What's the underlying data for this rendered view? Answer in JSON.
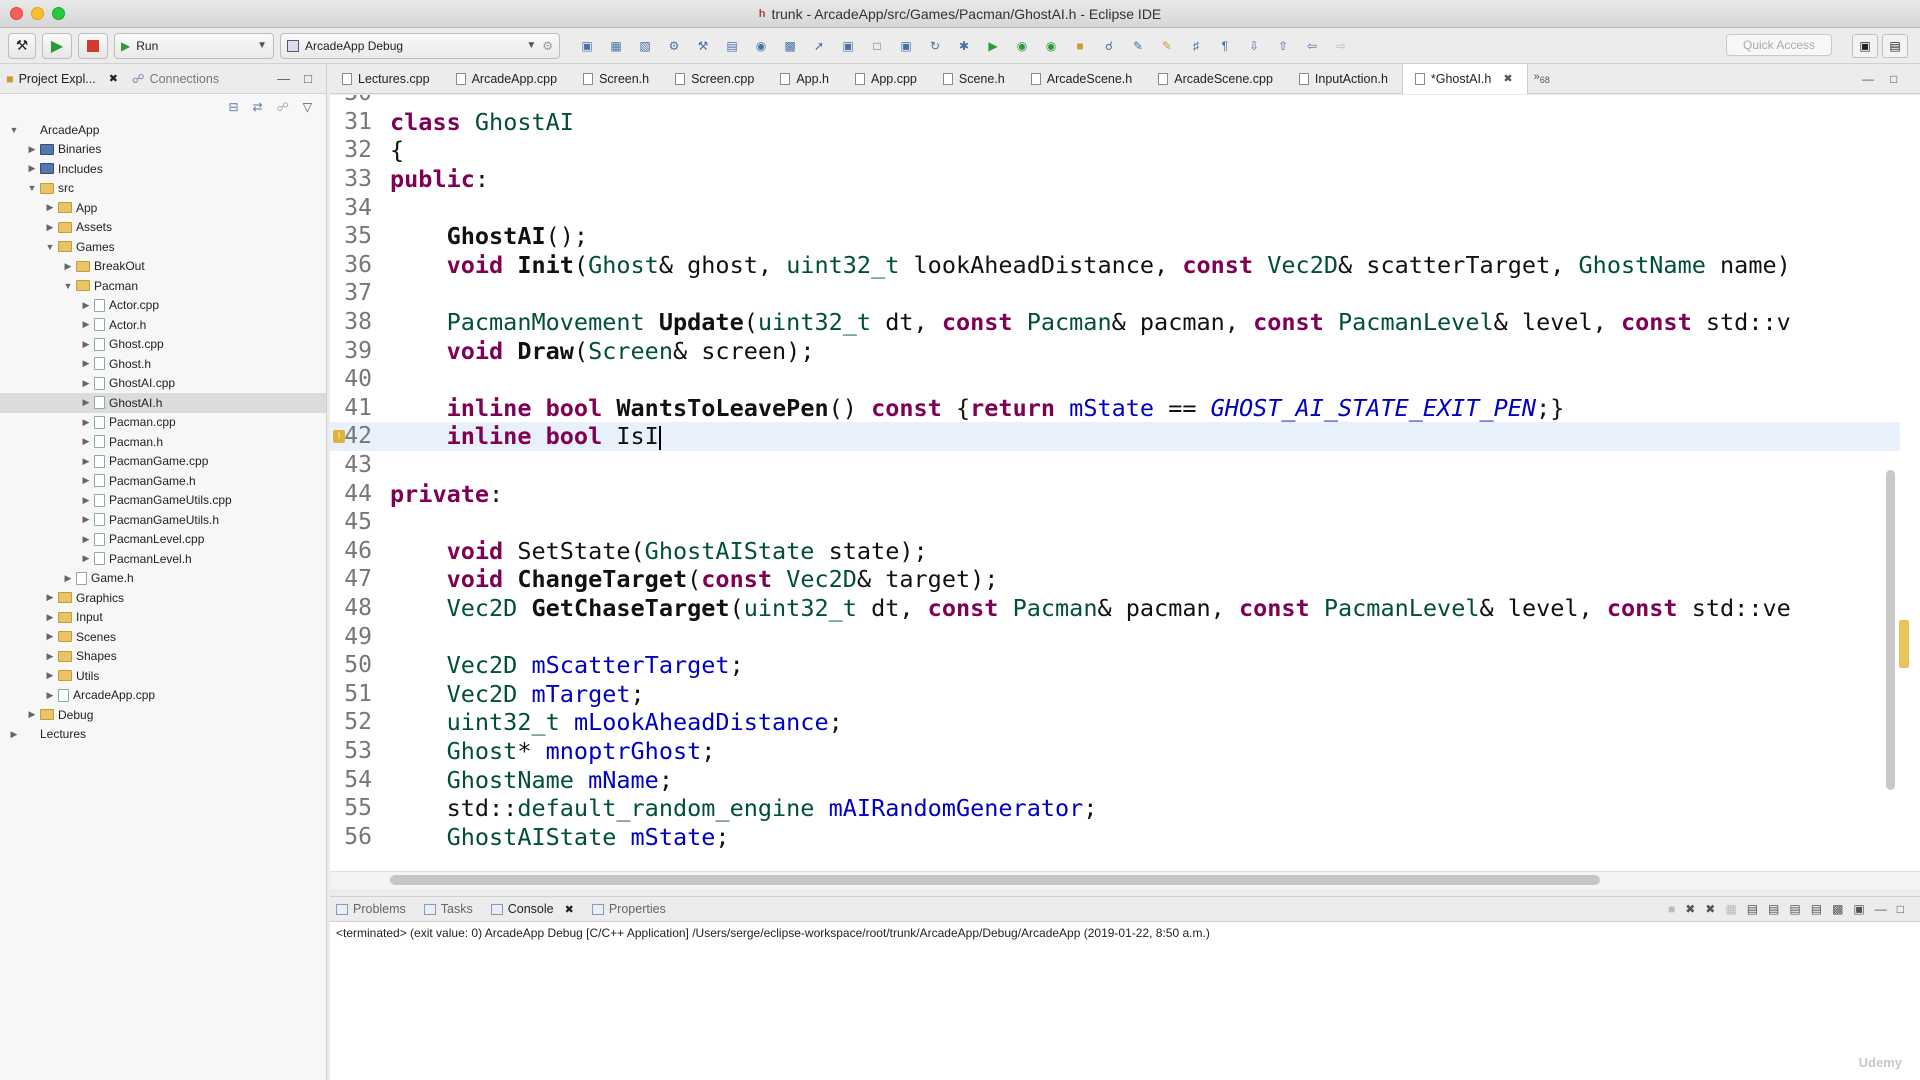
{
  "window": {
    "title": "trunk - ArcadeApp/src/Games/Pacman/GhostAI.h - Eclipse IDE"
  },
  "toolbar": {
    "run_label": "Run",
    "config_label": "ArcadeApp Debug",
    "quick_access_placeholder": "Quick Access"
  },
  "left_panel": {
    "tabs": [
      {
        "label": "Project Expl..."
      },
      {
        "label": "Connections"
      }
    ],
    "tree": [
      {
        "label": "ArcadeApp",
        "depth": 0,
        "kind": "project",
        "open": true
      },
      {
        "label": "Binaries",
        "depth": 1,
        "kind": "bin",
        "open": false
      },
      {
        "label": "Includes",
        "depth": 1,
        "kind": "bin",
        "open": false
      },
      {
        "label": "src",
        "depth": 1,
        "kind": "folder",
        "open": true
      },
      {
        "label": "App",
        "depth": 2,
        "kind": "folder",
        "open": false
      },
      {
        "label": "Assets",
        "depth": 2,
        "kind": "folder",
        "open": false
      },
      {
        "label": "Games",
        "depth": 2,
        "kind": "folder",
        "open": true
      },
      {
        "label": "BreakOut",
        "depth": 3,
        "kind": "folder",
        "open": false
      },
      {
        "label": "Pacman",
        "depth": 3,
        "kind": "folder",
        "open": true
      },
      {
        "label": "Actor.cpp",
        "depth": 4,
        "kind": "file",
        "open": false
      },
      {
        "label": "Actor.h",
        "depth": 4,
        "kind": "file",
        "open": false
      },
      {
        "label": "Ghost.cpp",
        "depth": 4,
        "kind": "file",
        "open": false
      },
      {
        "label": "Ghost.h",
        "depth": 4,
        "kind": "file",
        "open": false
      },
      {
        "label": "GhostAI.cpp",
        "depth": 4,
        "kind": "file",
        "open": false
      },
      {
        "label": "GhostAI.h",
        "depth": 4,
        "kind": "file",
        "open": false,
        "selected": true
      },
      {
        "label": "Pacman.cpp",
        "depth": 4,
        "kind": "file",
        "open": false
      },
      {
        "label": "Pacman.h",
        "depth": 4,
        "kind": "file",
        "open": false
      },
      {
        "label": "PacmanGame.cpp",
        "depth": 4,
        "kind": "file",
        "open": false
      },
      {
        "label": "PacmanGame.h",
        "depth": 4,
        "kind": "file",
        "open": false
      },
      {
        "label": "PacmanGameUtils.cpp",
        "depth": 4,
        "kind": "file",
        "open": false
      },
      {
        "label": "PacmanGameUtils.h",
        "depth": 4,
        "kind": "file",
        "open": false
      },
      {
        "label": "PacmanLevel.cpp",
        "depth": 4,
        "kind": "file",
        "open": false
      },
      {
        "label": "PacmanLevel.h",
        "depth": 4,
        "kind": "file",
        "open": false
      },
      {
        "label": "Game.h",
        "depth": 3,
        "kind": "file",
        "open": false
      },
      {
        "label": "Graphics",
        "depth": 2,
        "kind": "folder",
        "open": false
      },
      {
        "label": "Input",
        "depth": 2,
        "kind": "folder",
        "open": false
      },
      {
        "label": "Scenes",
        "depth": 2,
        "kind": "folder",
        "open": false
      },
      {
        "label": "Shapes",
        "depth": 2,
        "kind": "folder",
        "open": false
      },
      {
        "label": "Utils",
        "depth": 2,
        "kind": "folder",
        "open": false
      },
      {
        "label": "ArcadeApp.cpp",
        "depth": 2,
        "kind": "file",
        "open": false
      },
      {
        "label": "Debug",
        "depth": 1,
        "kind": "folder",
        "open": false
      },
      {
        "label": "Lectures",
        "depth": 0,
        "kind": "project",
        "open": false
      }
    ]
  },
  "editor_tabs": [
    {
      "label": "Lectures.cpp"
    },
    {
      "label": "ArcadeApp.cpp"
    },
    {
      "label": "Screen.h"
    },
    {
      "label": "Screen.cpp"
    },
    {
      "label": "App.h"
    },
    {
      "label": "App.cpp"
    },
    {
      "label": "Scene.h"
    },
    {
      "label": "ArcadeScene.h"
    },
    {
      "label": "ArcadeScene.cpp"
    },
    {
      "label": "InputAction.h"
    },
    {
      "label": "*GhostAI.h",
      "active": true
    }
  ],
  "editor_tabs_overflow": "68",
  "code_lines": [
    {
      "n": "30",
      "html": ""
    },
    {
      "n": "31",
      "html": "<span class=\"kw\">class</span> <span class=\"ty\">GhostAI</span>"
    },
    {
      "n": "32",
      "html": "{"
    },
    {
      "n": "33",
      "html": "<span class=\"kw\">public</span>:"
    },
    {
      "n": "34",
      "html": ""
    },
    {
      "n": "35",
      "html": "    <span class=\"fn\">GhostAI</span>();"
    },
    {
      "n": "36",
      "html": "    <span class=\"kw\">void</span> <span class=\"fn\">Init</span>(<span class=\"ty\">Ghost</span>&amp; ghost, <span class=\"ty\">uint32_t</span> lookAheadDistance, <span class=\"kw\">const</span> <span class=\"ty\">Vec2D</span>&amp; scatterTarget, <span class=\"ty\">GhostName</span> name)"
    },
    {
      "n": "37",
      "html": ""
    },
    {
      "n": "38",
      "html": "    <span class=\"ty\">PacmanMovement</span> <span class=\"fn\">Update</span>(<span class=\"ty\">uint32_t</span> dt, <span class=\"kw\">const</span> <span class=\"ty\">Pacman</span>&amp; pacman, <span class=\"kw\">const</span> <span class=\"ty\">PacmanLevel</span>&amp; level, <span class=\"kw\">const</span> std::v"
    },
    {
      "n": "39",
      "html": "    <span class=\"kw\">void</span> <span class=\"fn\">Draw</span>(<span class=\"ty\">Screen</span>&amp; screen);"
    },
    {
      "n": "40",
      "html": ""
    },
    {
      "n": "41",
      "html": "    <span class=\"kw\">inline</span> <span class=\"kw\">bool</span> <span class=\"fn\">WantsToLeavePen</span>() <span class=\"kw\">const</span> {<span class=\"kw\">return</span> <span class=\"fld\">mState</span> == <span class=\"en\">GHOST_AI_STATE_EXIT_PEN</span>;}"
    },
    {
      "n": "42",
      "html": "    <span class=\"kw\">inline</span> <span class=\"kw\">bool</span> IsI<span class=\"caret\"></span>",
      "current": true,
      "warn": true
    },
    {
      "n": "43",
      "html": ""
    },
    {
      "n": "44",
      "html": "<span class=\"kw\">private</span>:"
    },
    {
      "n": "45",
      "html": ""
    },
    {
      "n": "46",
      "html": "    <span class=\"kw\">void</span> SetState(<span class=\"ty\">GhostAIState</span> state);"
    },
    {
      "n": "47",
      "html": "    <span class=\"kw\">void</span> <span class=\"fn\">ChangeTarget</span>(<span class=\"kw\">const</span> <span class=\"ty\">Vec2D</span>&amp; target);"
    },
    {
      "n": "48",
      "html": "    <span class=\"ty\">Vec2D</span> <span class=\"fn\">GetChaseTarget</span>(<span class=\"ty\">uint32_t</span> dt, <span class=\"kw\">const</span> <span class=\"ty\">Pacman</span>&amp; pacman, <span class=\"kw\">const</span> <span class=\"ty\">PacmanLevel</span>&amp; level, <span class=\"kw\">const</span> std::ve"
    },
    {
      "n": "49",
      "html": ""
    },
    {
      "n": "50",
      "html": "    <span class=\"ty\">Vec2D</span> <span class=\"fld\">mScatterTarget</span>;"
    },
    {
      "n": "51",
      "html": "    <span class=\"ty\">Vec2D</span> <span class=\"fld\">mTarget</span>;"
    },
    {
      "n": "52",
      "html": "    <span class=\"ty\">uint32_t</span> <span class=\"fld\">mLookAheadDistance</span>;"
    },
    {
      "n": "53",
      "html": "    <span class=\"ty\">Ghost</span>* <span class=\"fld\">mnoptrGhost</span>;"
    },
    {
      "n": "54",
      "html": "    <span class=\"ty\">GhostName</span> <span class=\"fld\">mName</span>;"
    },
    {
      "n": "55",
      "html": "    std::<span class=\"ty\">default_random_engine</span> <span class=\"fld\">mAIRandomGenerator</span>;"
    },
    {
      "n": "56",
      "html": "    <span class=\"ty\">GhostAIState</span> <span class=\"fld\">mState</span>;"
    }
  ],
  "bottom_panel": {
    "tabs": [
      {
        "label": "Problems"
      },
      {
        "label": "Tasks"
      },
      {
        "label": "Console",
        "active": true
      },
      {
        "label": "Properties"
      }
    ],
    "console_text": "<terminated> (exit value: 0) ArcadeApp Debug [C/C++ Application] /Users/serge/eclipse-workspace/root/trunk/ArcadeApp/Debug/ArcadeApp (2019-01-22, 8:50 a.m.)"
  },
  "watermark": "Udemy"
}
